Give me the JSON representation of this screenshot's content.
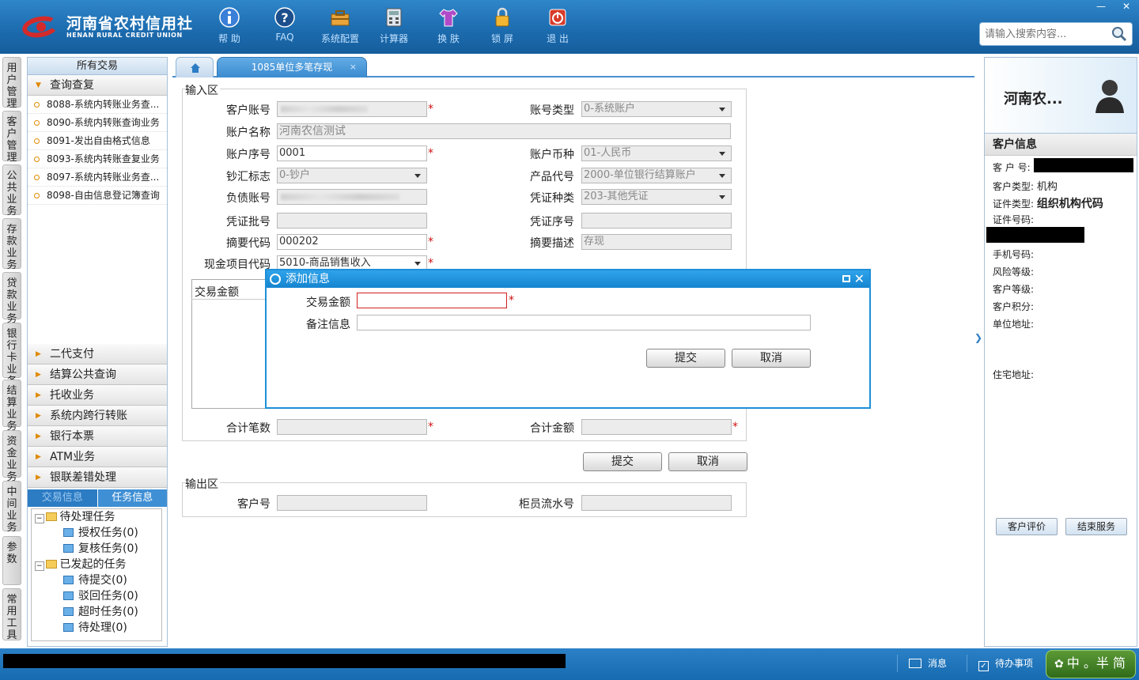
{
  "app": {
    "logo_cn": "河南省农村信用社",
    "logo_en": "HENAN RURAL CREDIT UNION"
  },
  "toolbar": {
    "help": "帮 助",
    "faq": "FAQ",
    "config": "系统配置",
    "calculator": "计算器",
    "skin": "换 肤",
    "lock": "锁 屏",
    "exit": "退 出"
  },
  "search": {
    "placeholder": "请输入搜索内容..."
  },
  "vtabs": [
    "用户管理",
    "客户管理",
    "公共业务",
    "存款业务",
    "贷款业务",
    "银行卡业务",
    "结算业务",
    "资金业务",
    "中间业务",
    "参数",
    "常用工具"
  ],
  "nav": {
    "header": "所有交易",
    "open_group": "查询查复",
    "items": [
      "8088-系统内转账业务查...",
      "8090-系统内转账查询业务",
      "8091-发出自由格式信息",
      "8093-系统内转账查复业务",
      "8097-系统内转账业务查...",
      "8098-自由信息登记簿查询"
    ],
    "groups": [
      "二代支付",
      "结算公共查询",
      "托收业务",
      "系统内跨行转账",
      "银行本票",
      "ATM业务",
      "银联差错处理"
    ],
    "task_tabs": [
      "交易信息",
      "任务信息"
    ],
    "tree": {
      "pending": "待处理任务",
      "auth": "授权任务(0)",
      "review": "复核任务(0)",
      "launched": "已发起的任务",
      "to_submit": "待提交(0)",
      "rejected": "驳回任务(0)",
      "timeout": "超时任务(0)",
      "to_process": "待处理(0)"
    }
  },
  "tab": {
    "title": "1085单位多笔存现",
    "close": "×"
  },
  "form": {
    "input_area": "输入区",
    "cust_account_label": "客户账号",
    "account_type_label": "账号类型",
    "account_type_value": "0-系统账户",
    "account_name_label": "账户名称",
    "account_name_value": "河南农信测试",
    "account_seq_label": "账户序号",
    "account_seq_value": "0001",
    "currency_label": "账户币种",
    "currency_value": "01-人民币",
    "cash_flag_label": "钞汇标志",
    "cash_flag_value": "0-钞户",
    "product_label": "产品代号",
    "product_value": "2000-单位银行结算账户",
    "liability_label": "负债账号",
    "voucher_type_label": "凭证种类",
    "voucher_type_value": "203-其他凭证",
    "voucher_batch_label": "凭证批号",
    "voucher_seq_label": "凭证序号",
    "summary_code_label": "摘要代码",
    "summary_code_value": "000202",
    "summary_desc_label": "摘要描述",
    "summary_desc_value": "存现",
    "cash_item_label": "现金项目代码",
    "cash_item_value": "5010-商品销售收入",
    "grid_col": "交易金额",
    "total_count_label": "合计笔数",
    "total_amount_label": "合计金额",
    "submit": "提交",
    "cancel": "取消",
    "output_area": "输出区",
    "out_cust_label": "客户号",
    "out_serial_label": "柜员流水号"
  },
  "dialog": {
    "title": "添加信息",
    "amount_label": "交易金额",
    "remark_label": "备注信息",
    "submit": "提交",
    "cancel": "取消"
  },
  "customer": {
    "name": "河南农...",
    "section": "客户信息",
    "cust_no": "客 户 号:",
    "cust_type_label": "客户类型:",
    "cust_type_value": "机构",
    "id_type_label": "证件类型:",
    "id_type_value": "组织机构代码",
    "id_no_label": "证件号码:",
    "phone_label": "手机号码:",
    "risk_label": "风险等级:",
    "level_label": "客户等级:",
    "points_label": "客户积分:",
    "company_addr_label": "单位地址:",
    "home_addr_label": "住宅地址:",
    "evaluate": "客户评价",
    "end_service": "结束服务"
  },
  "status": {
    "message": "消息",
    "todo": "待办事项",
    "ime": "中 。半 简"
  },
  "colors": {
    "brand": "#1b6aad",
    "accent": "#1e8fd8",
    "required": "#d01010"
  }
}
